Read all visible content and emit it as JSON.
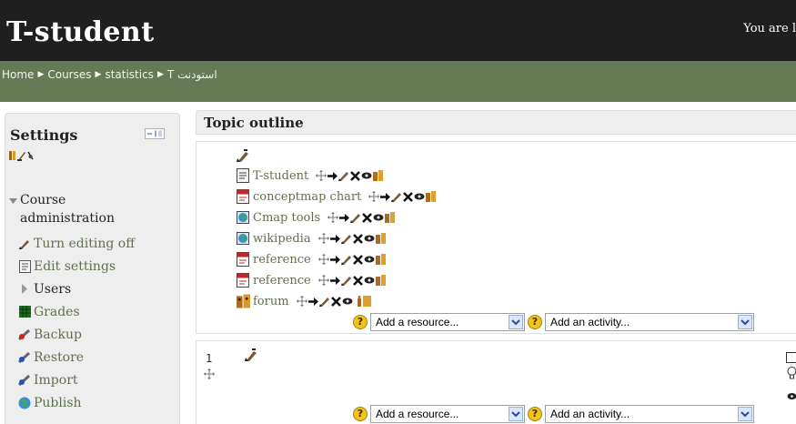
{
  "header": {
    "site_title": "T-student",
    "login_info": "You are l"
  },
  "breadcrumb": {
    "items": [
      "Home",
      "Courses",
      "statistics",
      "T استودنت"
    ],
    "separator": "▶"
  },
  "settings": {
    "title": "Settings",
    "course_admin_label": "Course administration",
    "items": [
      {
        "label": "Turn editing off",
        "icon": "edit-icon"
      },
      {
        "label": "Edit settings",
        "icon": "settings-doc-icon"
      },
      {
        "label": "Users",
        "icon": "expand-arrow-icon"
      },
      {
        "label": "Grades",
        "icon": "grades-icon"
      },
      {
        "label": "Backup",
        "icon": "backup-icon"
      },
      {
        "label": "Restore",
        "icon": "restore-icon"
      },
      {
        "label": "Import",
        "icon": "import-icon"
      },
      {
        "label": "Publish",
        "icon": "publish-icon"
      }
    ]
  },
  "topic": {
    "title": "Topic outline",
    "section0": {
      "activities": [
        {
          "name": "T-student",
          "icon": "page-icon"
        },
        {
          "name": "conceptmap chart",
          "icon": "pdf-icon"
        },
        {
          "name": "Cmap tools",
          "icon": "url-icon"
        },
        {
          "name": "wikipedia",
          "icon": "url-icon"
        },
        {
          "name": "reference",
          "icon": "pdf-icon"
        },
        {
          "name": "reference",
          "icon": "pdf-icon"
        },
        {
          "name": "forum",
          "icon": "forum-icon"
        }
      ]
    },
    "section1": {
      "number": "1"
    },
    "add_resource": "Add a resource...",
    "add_activity": "Add an activity..."
  },
  "colors": {
    "header_bg": "#1f1f1f",
    "navbar_bg": "#657a55",
    "link": "#60704c",
    "block_bg": "#eeeeee"
  }
}
